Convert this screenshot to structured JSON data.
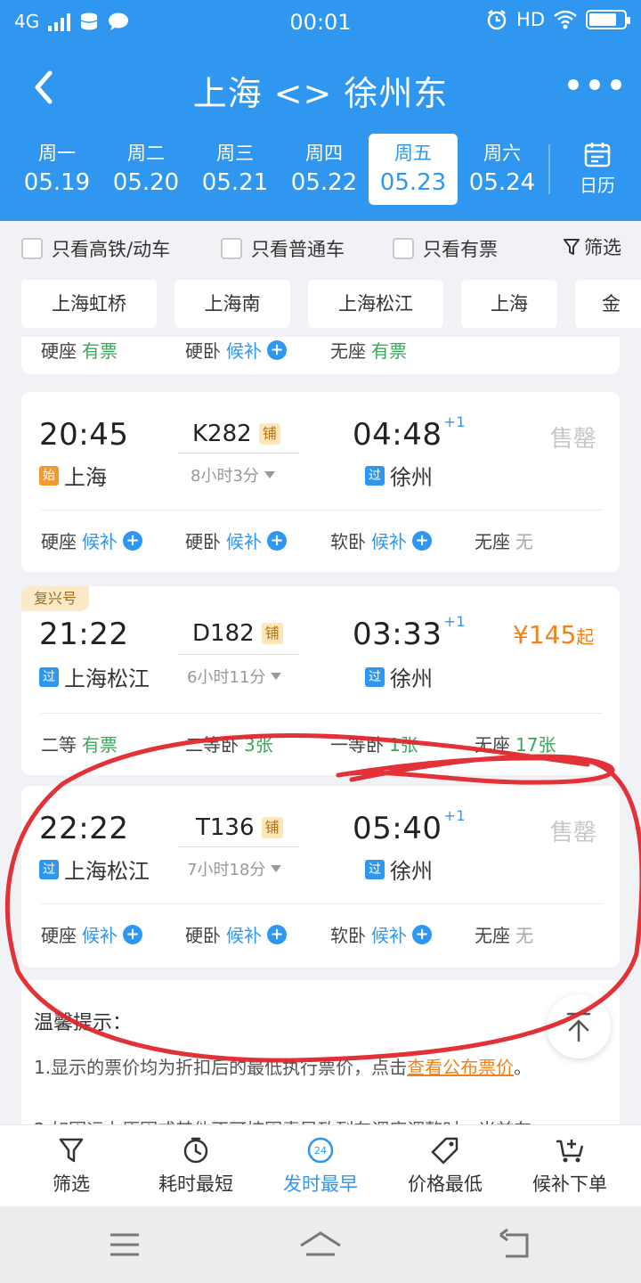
{
  "status_bar": {
    "network": "4G",
    "time": "00:01",
    "hd": "HD"
  },
  "nav": {
    "title": "上海 <> 徐州东"
  },
  "dates": [
    {
      "week": "周一",
      "date": "05.19"
    },
    {
      "week": "周二",
      "date": "05.20"
    },
    {
      "week": "周三",
      "date": "05.21"
    },
    {
      "week": "周四",
      "date": "05.22"
    },
    {
      "week": "周五",
      "date": "05.23"
    },
    {
      "week": "周六",
      "date": "05.24"
    }
  ],
  "calendar_label": "日历",
  "filters": {
    "high_speed": "只看高铁/动车",
    "normal": "只看普通车",
    "available": "只看有票",
    "filter": "筛选"
  },
  "stations": [
    "上海虹桥",
    "上海南",
    "上海松江",
    "上海",
    "金"
  ],
  "partial_seats": [
    {
      "type": "硬座",
      "status": "有票"
    },
    {
      "type": "硬卧",
      "status": "候补"
    },
    {
      "type": "无座",
      "status": "有票"
    }
  ],
  "trains": [
    {
      "dep_time": "20:45",
      "dep_tag": "始",
      "dep_station": "上海",
      "train_no": "K282",
      "berth": "铺",
      "duration": "8小时3分",
      "arr_time": "04:48",
      "arr_plus": "+1",
      "arr_tag": "过",
      "arr_station": "徐州",
      "status": "售罄",
      "seats": [
        {
          "type": "硬座",
          "status": "候补"
        },
        {
          "type": "硬卧",
          "status": "候补"
        },
        {
          "type": "软卧",
          "status": "候补"
        },
        {
          "type": "无座",
          "status": "无"
        }
      ]
    },
    {
      "badge": "复兴号",
      "dep_time": "21:22",
      "dep_tag": "过",
      "dep_station": "上海松江",
      "train_no": "D182",
      "berth": "铺",
      "duration": "6小时11分",
      "arr_time": "03:33",
      "arr_plus": "+1",
      "arr_tag": "过",
      "arr_station": "徐州",
      "price": "¥145",
      "price_suffix": "起",
      "seats": [
        {
          "type": "二等",
          "status": "有票"
        },
        {
          "type": "二等卧",
          "status": "3张"
        },
        {
          "type": "一等卧",
          "status": "1张"
        },
        {
          "type": "无座",
          "status": "17张"
        }
      ]
    },
    {
      "dep_time": "22:22",
      "dep_tag": "过",
      "dep_station": "上海松江",
      "train_no": "T136",
      "berth": "铺",
      "duration": "7小时18分",
      "arr_time": "05:40",
      "arr_plus": "+1",
      "arr_tag": "过",
      "arr_station": "徐州",
      "status": "售罄",
      "seats": [
        {
          "type": "硬座",
          "status": "候补"
        },
        {
          "type": "硬卧",
          "status": "候补"
        },
        {
          "type": "软卧",
          "status": "候补"
        },
        {
          "type": "无座",
          "status": "无"
        }
      ]
    }
  ],
  "tips": {
    "title": "温馨提示：",
    "line1": "1.显示的票价均为折扣后的最低执行票价，点击",
    "link": "查看公布票价",
    "line1_end": "。",
    "line2": "2.如因运力原因或其他不可控因素导致列车调度调整时，当前车"
  },
  "tabs": [
    {
      "label": "筛选",
      "icon": "funnel-icon"
    },
    {
      "label": "耗时最短",
      "icon": "timer-icon"
    },
    {
      "label": "发时最早",
      "icon": "clock-24-icon",
      "active": true
    },
    {
      "label": "价格最低",
      "icon": "price-tag-icon"
    },
    {
      "label": "候补下单",
      "icon": "cart-plus-icon"
    }
  ],
  "colors": {
    "primary": "#2f97f0",
    "accent": "#f08219",
    "available": "#3aa85a",
    "annotation": "#e0262c"
  }
}
